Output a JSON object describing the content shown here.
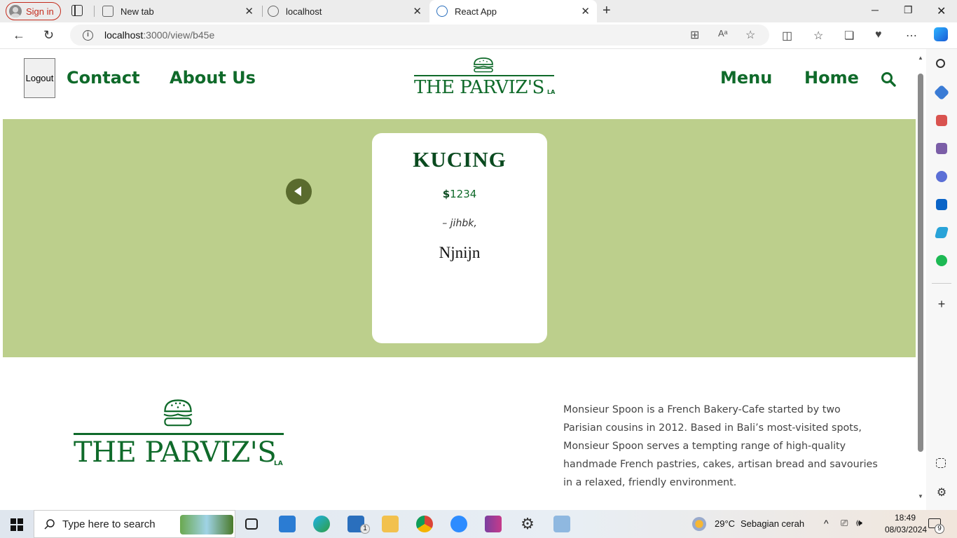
{
  "browser": {
    "signin_label": "Sign in",
    "tabs": [
      {
        "label": "New tab",
        "icon": "new-tab-icon"
      },
      {
        "label": "localhost",
        "icon": "page-icon"
      },
      {
        "label": "React App",
        "icon": "react-icon"
      }
    ],
    "url_host": "localhost",
    "url_path": ":3000/view/b45e"
  },
  "site": {
    "logout_label": "Logout",
    "nav_left": [
      "Contact",
      "About Us"
    ],
    "nav_right": [
      "Menu",
      "Home"
    ],
    "logo_text": "THE PARVIZ'S",
    "logo_suffix": "LA",
    "brand_color": "#0f6a2a",
    "hero_color": "#bccf8c"
  },
  "item": {
    "title": "KUCING",
    "price": "1234",
    "currency_symbol": "$",
    "description": "– jihbk,",
    "note": "Njnijn"
  },
  "footer": {
    "about": "Monsieur Spoon is a French Bakery-Cafe started by two Parisian cousins in 2012. Based in Bali’s most-visited spots, Monsieur Spoon serves a tempting range of high-quality handmade French pastries, cakes, artisan bread and savouries in a relaxed, friendly environment."
  },
  "taskbar": {
    "search_placeholder": "Type here to search",
    "weather_temp": "29°C",
    "weather_desc": "Sebagian cerah",
    "time": "18:49",
    "date": "08/03/2024",
    "mail_badge": "1",
    "notification_badge": "9"
  }
}
